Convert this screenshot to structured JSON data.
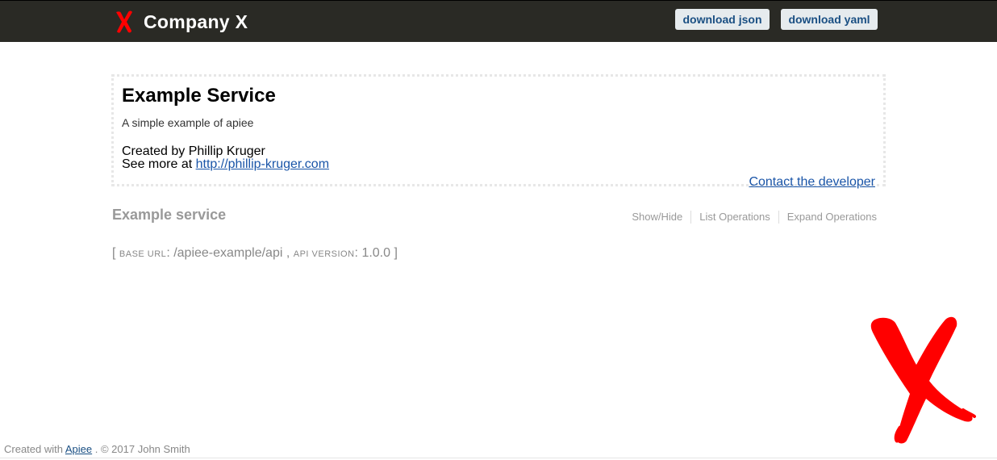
{
  "header": {
    "title": "Company X",
    "logo_icon": "red-x-logo-icon",
    "background_color": "#2a2a25",
    "buttons": {
      "download_json": "download json",
      "download_yaml": "download yaml"
    }
  },
  "info": {
    "title": "Example Service",
    "description": "A simple example of apiee",
    "created_by": "Created by Phillip Kruger",
    "see_more_prefix": "See more at",
    "see_more_link": "http://phillip-kruger.com",
    "contact_link": "Contact the developer"
  },
  "service": {
    "name": "Example service",
    "operations": [
      "Show/Hide",
      "List Operations",
      "Expand Operations"
    ],
    "base_url_label": "base url",
    "base_url": "/apiee-example/api",
    "api_version_label": "api version",
    "api_version": "1.0.0"
  },
  "footer": {
    "prefix": "Created with",
    "link": "Apiee",
    "suffix": ". © 2017 John Smith"
  },
  "colors": {
    "accent_red": "#ff0000",
    "link_blue": "#1a55a8",
    "muted_gray": "#999999"
  }
}
